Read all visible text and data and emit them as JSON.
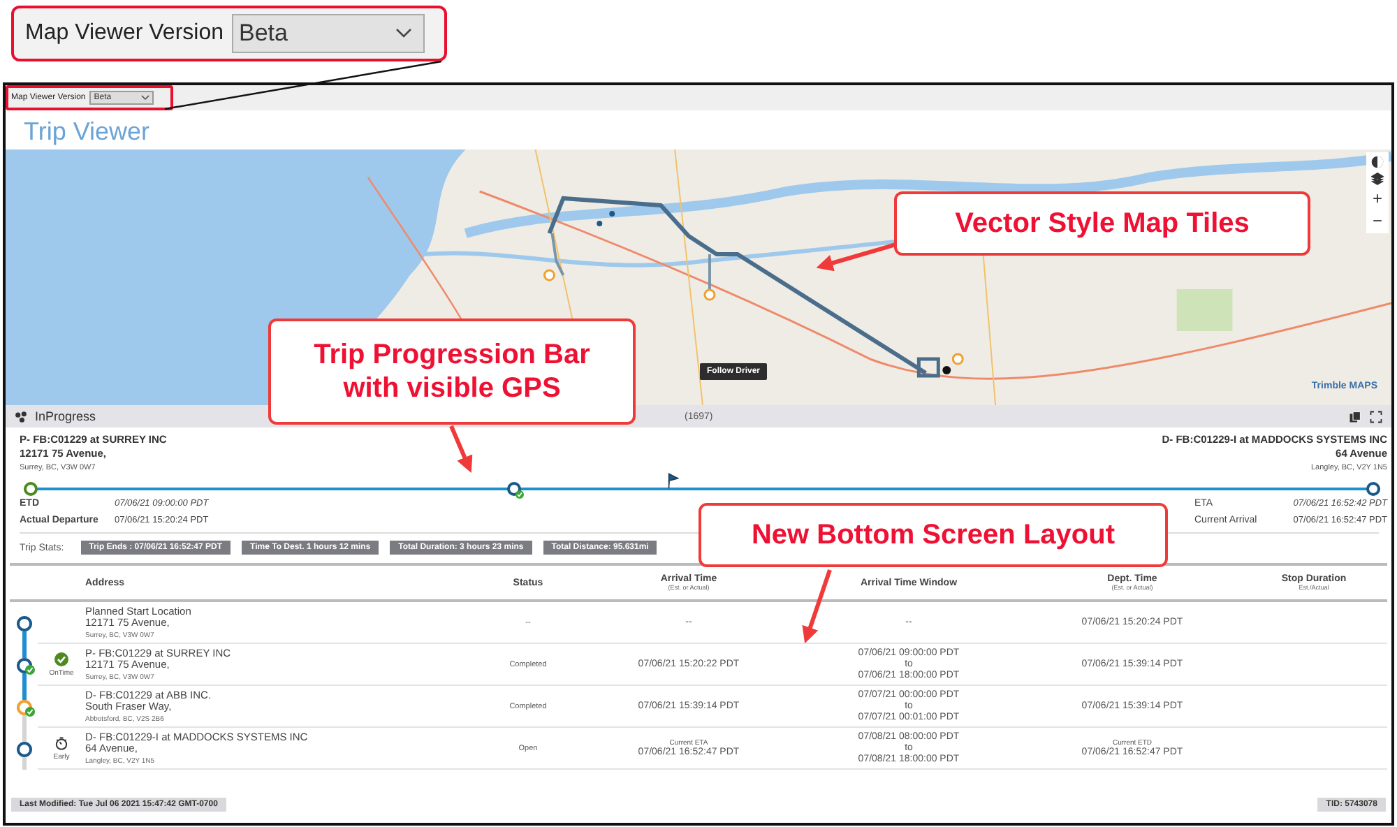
{
  "zoom_callout": {
    "label": "Map Viewer Version",
    "value": "Beta"
  },
  "toolbar": {
    "label": "Map Viewer Version",
    "value": "Beta"
  },
  "page_title": "Trip Viewer",
  "map": {
    "follow_button": "Follow Driver",
    "zoom_in": "+",
    "zoom_out": "−",
    "attribution": "Trimble MAPS"
  },
  "callouts": [
    {
      "text": "Vector Style Map Tiles"
    },
    {
      "text": "Trip Progression Bar with visible GPS"
    },
    {
      "text": "New Bottom Screen Layout"
    }
  ],
  "trip_panel": {
    "status": "InProgress",
    "count": "(1697)",
    "origin": {
      "name": "P- FB:C01229 at SURREY INC",
      "street": "12171 75 Avenue,",
      "city": "Surrey, BC, V3W 0W7"
    },
    "destination": {
      "name": "D- FB:C01229-I at MADDOCKS SYSTEMS INC",
      "street": "64 Avenue",
      "city": "Langley, BC, V2Y 1N5"
    },
    "progress": {
      "level": 0.475,
      "stops": [
        {
          "level": 0,
          "color": "#4e8a1e",
          "completed": false
        },
        {
          "level": 0.36,
          "color": "#1a5a8a",
          "completed": true
        },
        {
          "level": 1,
          "color": "#1a5a8a",
          "completed": false
        }
      ]
    },
    "left_times": [
      {
        "label": "ETD",
        "value": "07/06/21 09:00:00 PDT",
        "kind": "estimate"
      },
      {
        "label": "Actual Departure",
        "value": "07/06/21 15:20:24 PDT",
        "kind": "actual"
      }
    ],
    "right_times": [
      {
        "label": "ETA",
        "value": "07/06/21 16:52:42 PDT",
        "kind": "estimate"
      },
      {
        "label": "Current Arrival",
        "value": "07/06/21 16:52:47 PDT",
        "kind": "actual"
      }
    ],
    "stats_label": "Trip Stats:",
    "stats": [
      "Trip Ends : 07/06/21 16:52:47 PDT",
      "Time To Dest. 1 hours 12 mins",
      "Total Duration: 3 hours 23 mins",
      "Total Distance: 95.631mi"
    ]
  },
  "table": {
    "columns": [
      {
        "title": "Address"
      },
      {
        "title": "Status"
      },
      {
        "title": "Arrival Time",
        "subtitle": "(Est. or Actual)"
      },
      {
        "title": "Arrival Time Window"
      },
      {
        "title": "Dept. Time",
        "subtitle": "(Est. or Actual)"
      },
      {
        "title": "Stop Duration",
        "subtitle": "Est./Actual"
      }
    ],
    "rows": [
      {
        "color": "#1a5a8a",
        "completed": false,
        "name": "Planned Start Location",
        "street": "12171 75 Avenue,",
        "city": "Surrey, BC, V3W 0W7",
        "status": "--",
        "arrival": [
          "--"
        ],
        "window": [
          "--"
        ],
        "departure": [
          "07/06/21 15:20:24 PDT"
        ]
      },
      {
        "color": "#1a5a8a",
        "completed": true,
        "badge": {
          "kind": "ontime",
          "label": "OnTime"
        },
        "name": "P- FB:C01229 at SURREY INC",
        "street": "12171 75 Avenue,",
        "city": "Surrey, BC, V3W 0W7",
        "status": "Completed",
        "arrival": [
          "07/06/21 15:20:22 PDT"
        ],
        "window": [
          "07/06/21 09:00:00 PDT",
          "to",
          "07/06/21 18:00:00 PDT"
        ],
        "departure": [
          "07/06/21 15:39:14 PDT"
        ]
      },
      {
        "color": "#f0a030",
        "completed": true,
        "name": "D- FB:C01229 at ABB INC.",
        "street": "South Fraser Way,",
        "city": "Abbotsford, BC, V2S 2B6",
        "status": "Completed",
        "arrival": [
          "07/06/21 15:39:14 PDT"
        ],
        "window": [
          "07/07/21 00:00:00 PDT",
          "to",
          "07/07/21 00:01:00 PDT"
        ],
        "departure": [
          "07/06/21 15:39:14 PDT"
        ]
      },
      {
        "color": "#1a5a8a",
        "completed": false,
        "badge": {
          "kind": "early",
          "label": "Early"
        },
        "name": "D- FB:C01229-I at MADDOCKS SYSTEMS INC",
        "street": "64 Avenue,",
        "city": "Langley, BC, V2Y 1N5",
        "status": "Open",
        "arrival_note": "Current ETA",
        "arrival": [
          "07/06/21 16:52:47 PDT"
        ],
        "window": [
          "07/08/21 08:00:00 PDT",
          "to",
          "07/08/21 18:00:00 PDT"
        ],
        "departure_note": "Current ETD",
        "departure": [
          "07/06/21 16:52:47 PDT"
        ]
      }
    ]
  },
  "footer": {
    "last_modified": "Last Modified: Tue Jul 06 2021 15:47:42 GMT-0700",
    "tid": "TID: 5743078"
  }
}
